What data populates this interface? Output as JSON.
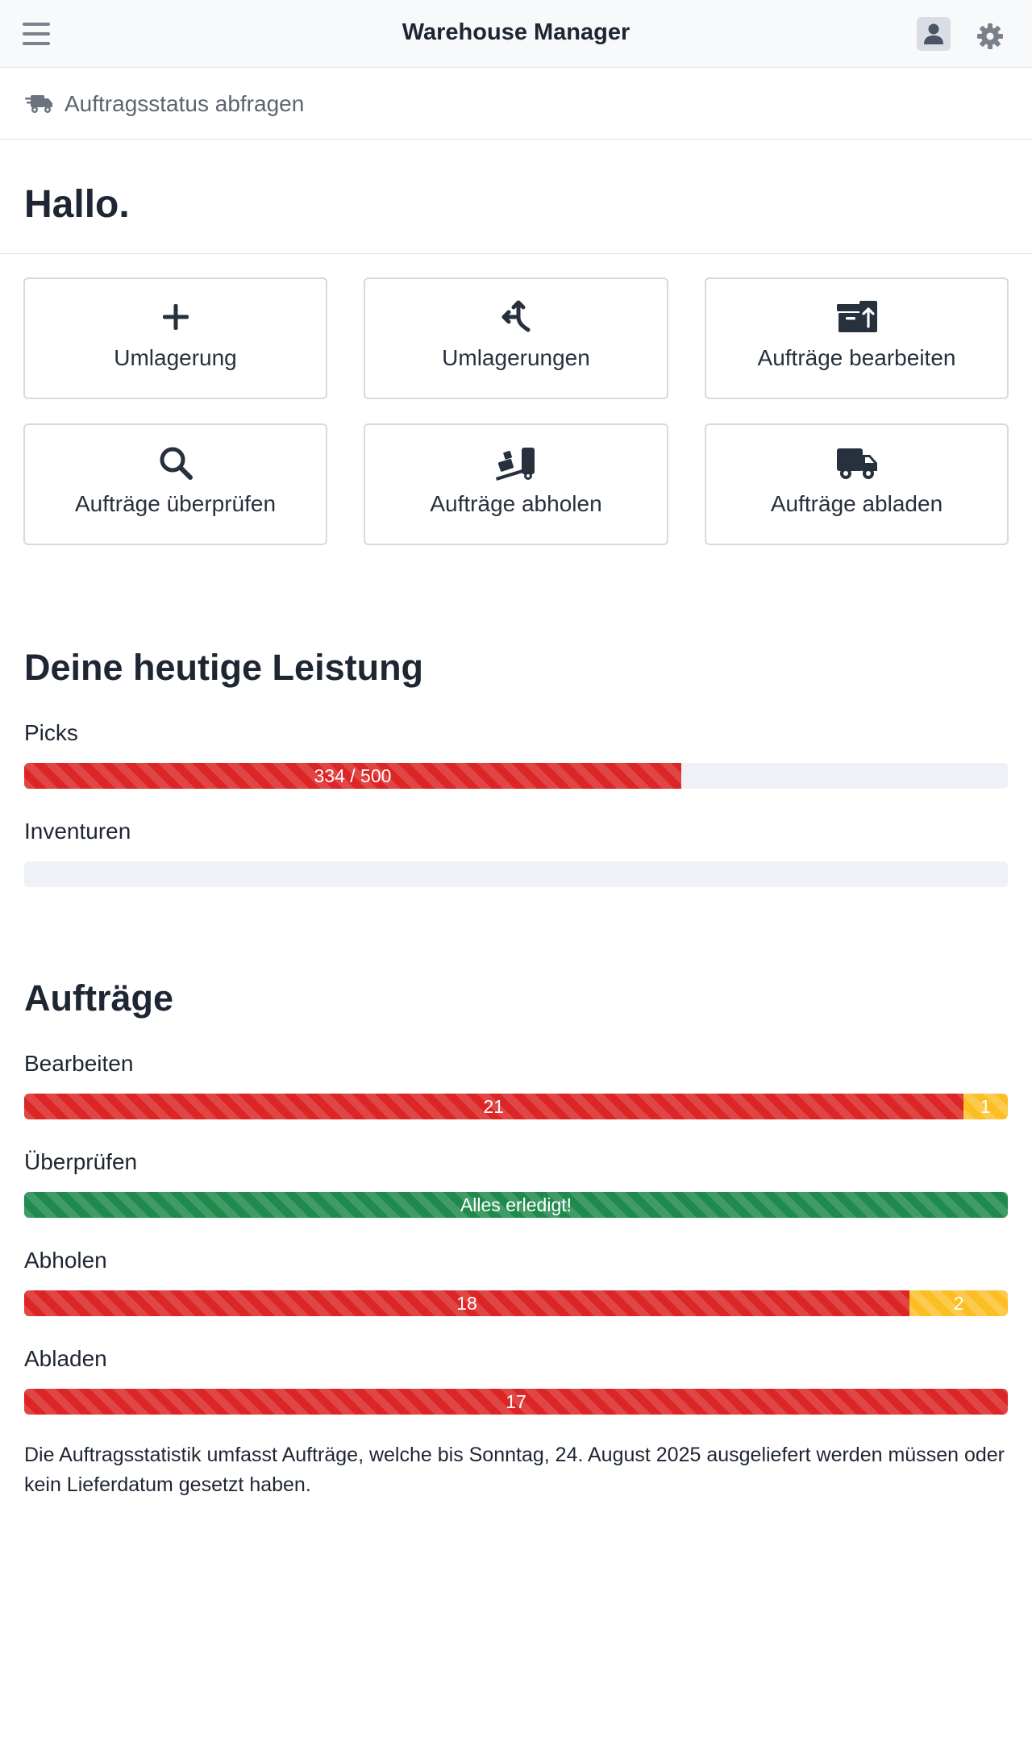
{
  "header": {
    "title": "Warehouse Manager",
    "menu_icon": "hamburger-menu-icon",
    "user_icon": "user-icon",
    "settings_icon": "gear-icon"
  },
  "subnav": {
    "label": "Auftragsstatus abfragen",
    "icon": "truck-fast-icon"
  },
  "greeting": "Hallo.",
  "tiles": [
    {
      "label": "Umlagerung",
      "icon": "plus-icon"
    },
    {
      "label": "Umlagerungen",
      "icon": "split-arrows-icon"
    },
    {
      "label": "Aufträge bearbeiten",
      "icon": "boxes-arrow-up-icon"
    },
    {
      "label": "Aufträge überprüfen",
      "icon": "search-icon"
    },
    {
      "label": "Aufträge abholen",
      "icon": "dolly-icon"
    },
    {
      "label": "Aufträge abladen",
      "icon": "truck-icon"
    }
  ],
  "performance": {
    "title": "Deine heutige Leistung",
    "picks": {
      "label": "Picks",
      "done": 334,
      "target": 500,
      "text": "334 / 500",
      "color": "#dc2626"
    },
    "inventuren": {
      "label": "Inventuren",
      "progress": 0
    }
  },
  "orders": {
    "title": "Aufträge",
    "rows": [
      {
        "label": "Bearbeiten",
        "red": 21,
        "yellow": 1,
        "red_text": "21",
        "yellow_text": "1"
      },
      {
        "label": "Überprüfen",
        "done_text": "Alles erledigt!"
      },
      {
        "label": "Abholen",
        "red": 18,
        "yellow": 2,
        "red_text": "18",
        "yellow_text": "2"
      },
      {
        "label": "Abladen",
        "red": 17,
        "yellow": 0,
        "red_text": "17"
      }
    ]
  },
  "footnote": "Die Auftragsstatistik umfasst Aufträge, welche bis Sonntag, 24. August 2025 ausgeliefert werden müssen oder kein Lieferdatum gesetzt haben.",
  "colors": {
    "red": "#dc2626",
    "yellow": "#fbbf24",
    "green": "#1f8a4c",
    "track": "#eef1f5"
  }
}
